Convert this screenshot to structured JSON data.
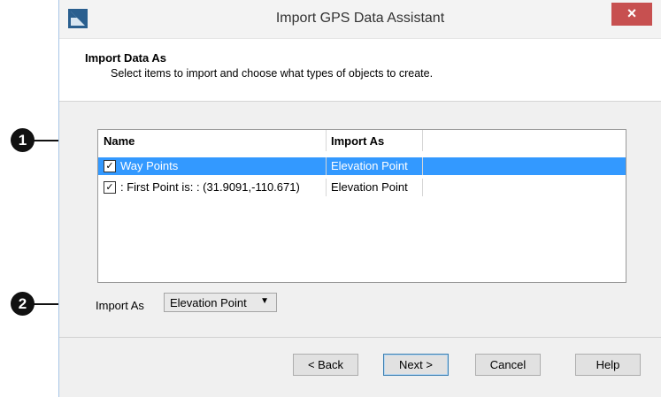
{
  "callouts": [
    "1",
    "2"
  ],
  "window": {
    "title": "Import GPS Data Assistant",
    "close_glyph": "×"
  },
  "header": {
    "title": "Import Data As",
    "subtitle": "Select items to import and choose what types of objects to create."
  },
  "list": {
    "columns": [
      "Name",
      "Import As"
    ],
    "rows": [
      {
        "checked": true,
        "name": "Way Points",
        "import_as": "Elevation Point",
        "selected": true
      },
      {
        "checked": true,
        "name": ": First Point is: : (31.9091,-110.671)",
        "import_as": "Elevation Point",
        "selected": false
      }
    ]
  },
  "import_as": {
    "label": "Import As",
    "value": "Elevation Point"
  },
  "buttons": {
    "back": "< Back",
    "next": "Next >",
    "cancel": "Cancel",
    "help": "Help"
  },
  "colors": {
    "selection": "#3399ff",
    "close": "#c75050",
    "app_icon": "#2a5f8f"
  },
  "icons": {
    "check": "✓",
    "dropdown": "▼"
  }
}
